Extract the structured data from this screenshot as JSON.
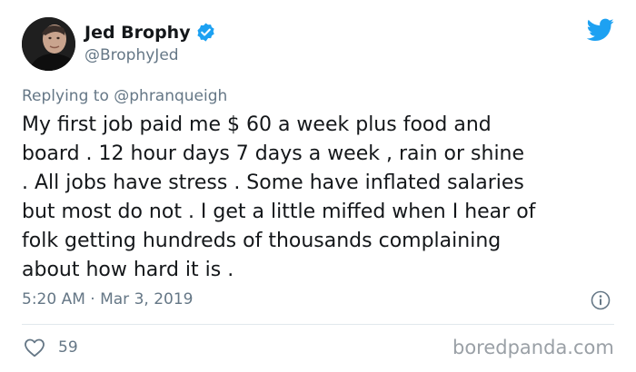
{
  "author": {
    "display_name": "Jed Brophy",
    "handle": "@BrophyJed",
    "verified": true,
    "avatar": "profile-photo"
  },
  "reply": {
    "prefix": "Replying to ",
    "to_handle": "@phranqueigh"
  },
  "tweet": {
    "text": "My first job paid me $ 60 a week plus food and\nboard  . 12 hour days 7 days a week , rain or shine\n. All jobs have stress . Some have inflated salaries\nbut most do not . I get a little miffed when I hear of\nfolk getting hundreds of thousands complaining\nabout how hard it is .",
    "timestamp": "5:20 AM · Mar 3, 2019"
  },
  "actions": {
    "like_count": "59",
    "like_icon": "heart-outline-icon",
    "info_icon": "info-circle-icon"
  },
  "branding": {
    "twitter_icon": "twitter-bird-icon",
    "watermark": "boredpanda.com"
  },
  "colors": {
    "twitter_blue": "#1da1f2",
    "secondary_text": "#657786",
    "primary_text": "#14171a",
    "divider": "#e1e8ed"
  }
}
